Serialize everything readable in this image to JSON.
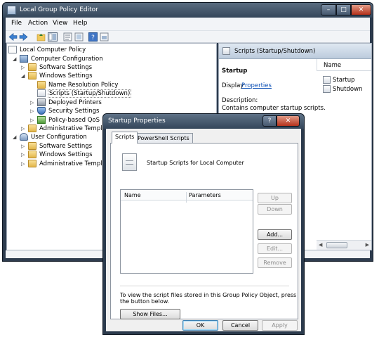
{
  "main_window": {
    "title": "Local Group Policy Editor",
    "controls": {
      "minimize": "–",
      "maximize": "□",
      "close": "✕"
    },
    "menu": [
      "File",
      "Action",
      "View",
      "Help"
    ]
  },
  "tree": {
    "items": [
      {
        "label": "Local Computer Policy",
        "icon": "computer-policy-icon"
      },
      {
        "label": "Computer Configuration",
        "icon": "computer-icon",
        "expander": "◢"
      },
      {
        "label": "Software Settings",
        "icon": "folder-icon",
        "expander": "▷"
      },
      {
        "label": "Windows Settings",
        "icon": "folder-icon",
        "expander": "◢"
      },
      {
        "label": "Name Resolution Policy",
        "icon": "folder-icon",
        "expander": ""
      },
      {
        "label": "Scripts (Startup/Shutdown)",
        "icon": "script-icon",
        "expander": ""
      },
      {
        "label": "Deployed Printers",
        "icon": "printer-icon",
        "expander": "▷"
      },
      {
        "label": "Security Settings",
        "icon": "shield-icon",
        "expander": "▷"
      },
      {
        "label": "Policy-based QoS",
        "icon": "qos-icon",
        "expander": "▷"
      },
      {
        "label": "Administrative Templates",
        "icon": "folder-icon",
        "expander": "▷"
      },
      {
        "label": "User Configuration",
        "icon": "user-icon",
        "expander": "◢"
      },
      {
        "label": "Software Settings",
        "icon": "folder-icon",
        "expander": "▷"
      },
      {
        "label": "Windows Settings",
        "icon": "folder-icon",
        "expander": "▷"
      },
      {
        "label": "Administrative Templates",
        "icon": "folder-icon",
        "expander": "▷"
      }
    ]
  },
  "right_pane": {
    "header": "Scripts (Startup/Shutdown)",
    "heading": "Startup",
    "display_label": "Display",
    "display_link": "Properties",
    "description_label": "Description:",
    "description_text": "Contains computer startup scripts.",
    "list_header": "Name",
    "list_items": [
      "Startup",
      "Shutdown"
    ]
  },
  "dialog": {
    "title": "Startup Properties",
    "controls": {
      "help": "?",
      "close": "✕"
    },
    "tabs": [
      "Scripts",
      "PowerShell Scripts"
    ],
    "heading": "Startup Scripts for Local Computer",
    "columns": [
      "Name",
      "Parameters"
    ],
    "buttons": {
      "up": "Up",
      "down": "Down",
      "add": "Add...",
      "edit": "Edit...",
      "remove": "Remove",
      "show_files": "Show Files...",
      "ok": "OK",
      "cancel": "Cancel",
      "apply": "Apply"
    },
    "info_line1": "To view the script files stored in this Group Policy Object, press",
    "info_line2": "the button below."
  }
}
